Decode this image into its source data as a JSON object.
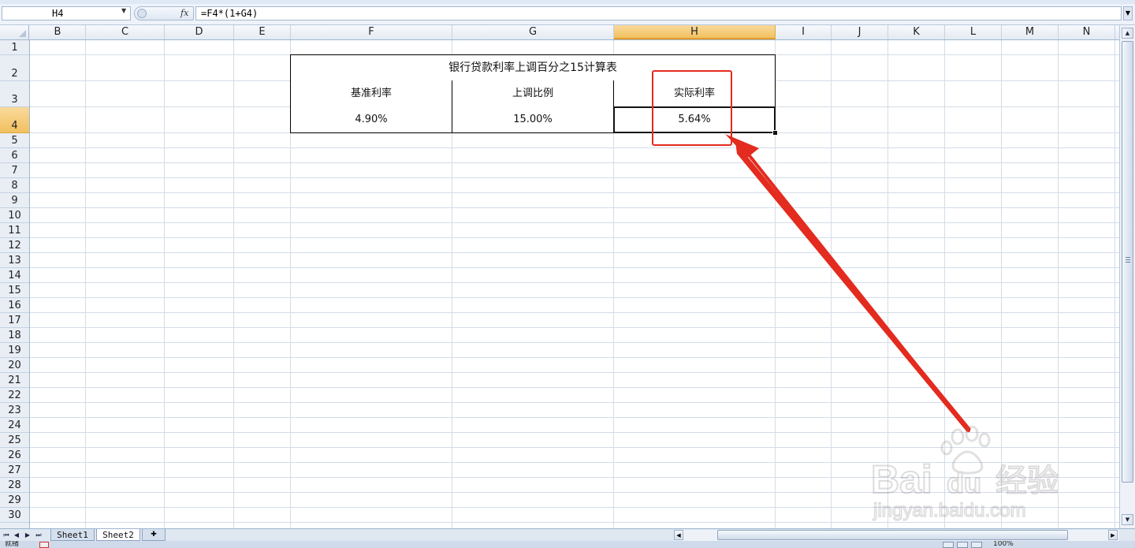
{
  "formula_bar": {
    "name_box": "H4",
    "fx_label": "fx",
    "formula": "=F4*(1+G4)"
  },
  "columns": [
    "B",
    "C",
    "D",
    "E",
    "F",
    "G",
    "H",
    "I",
    "J",
    "K",
    "L",
    "M",
    "N"
  ],
  "active_column": "H",
  "rows": [
    "1",
    "2",
    "3",
    "4",
    "5",
    "6",
    "7",
    "8",
    "9",
    "10",
    "11",
    "12",
    "13",
    "14",
    "15",
    "16",
    "17",
    "18",
    "19",
    "20",
    "21",
    "22",
    "23",
    "24",
    "25",
    "26",
    "27",
    "28",
    "29",
    "30"
  ],
  "active_row": "4",
  "table": {
    "title": "银行贷款利率上调百分之15计算表",
    "headers": [
      "基准利率",
      "上调比例",
      "实际利率"
    ],
    "values": [
      "4.90%",
      "15.00%",
      "5.64%"
    ]
  },
  "selected_cell": "H4",
  "sheet_tabs": [
    "Sheet1",
    "Sheet2"
  ],
  "active_sheet": "Sheet2",
  "status": {
    "ready_text": "就绪",
    "zoom": "100%"
  },
  "annotation": {
    "color": "#e32b1f"
  },
  "watermark": {
    "brand": "Bai",
    "brand_du": "du",
    "product": "经验",
    "url": "jingyan.baidu.com"
  }
}
